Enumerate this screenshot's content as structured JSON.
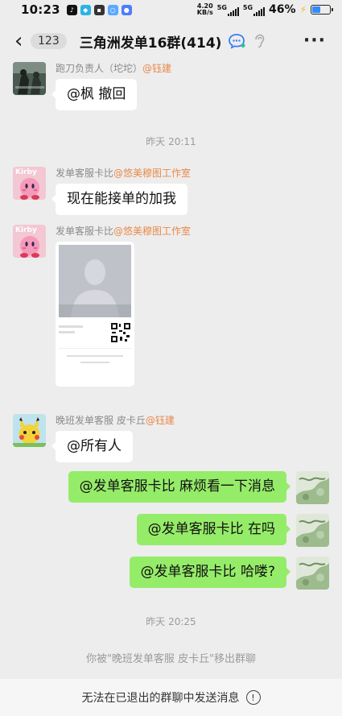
{
  "status": {
    "time": "10:23",
    "net_speed_value": "4.20",
    "net_speed_unit": "KB/s",
    "net1": "5G",
    "net2": "5G",
    "battery": "46%",
    "battery_level": 0.46
  },
  "nav": {
    "unread_count": "123",
    "title": "三角洲发单16群(414)"
  },
  "messages": [
    {
      "sender": "跑刀负责人（坨坨）",
      "mention": "@钰建",
      "text": "@枫 撤回"
    },
    {
      "time": "昨天 20:11"
    },
    {
      "sender": "发单客服卡比",
      "mention": "@悠美穆图工作室",
      "text": "现在能接单的加我"
    },
    {
      "sender": "发单客服卡比",
      "mention": "@悠美穆图工作室",
      "card": true
    },
    {
      "sender": "晚班发单客服  皮卡丘",
      "mention": "@钰建",
      "text": "@所有人"
    }
  ],
  "outgoing": [
    {
      "text": "@发单客服卡比  麻烦看一下消息"
    },
    {
      "text": "@发单客服卡比  在吗"
    },
    {
      "text": "@发单客服卡比  哈喽?"
    }
  ],
  "time2": "昨天 20:25",
  "system_message": "你被\"晚班发单客服  皮卡丘\"移出群聊",
  "bottom_notice": "无法在已退出的群聊中发送消息",
  "colors": {
    "outgoing_bubble": "#95ec69",
    "mention": "#e8894a",
    "background": "#ededed"
  }
}
